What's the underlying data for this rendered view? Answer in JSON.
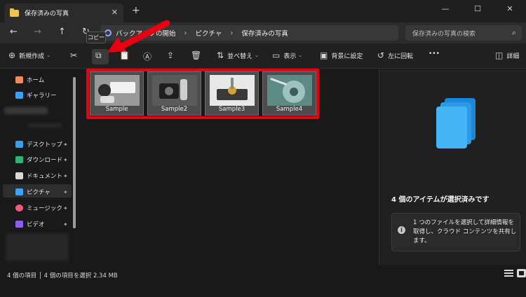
{
  "window": {
    "tab_title": "保存済みの写真",
    "new_tab": "+",
    "close_tab": "✕",
    "minimize": "—",
    "maximize": "☐",
    "close": "✕"
  },
  "address": {
    "crumbs": [
      "バックアップの開始",
      "ピクチャ",
      "保存済みの写真"
    ],
    "separator": "›",
    "search_placeholder": "保存済みの写真の検索"
  },
  "toolbar": {
    "new_label": "新規作成",
    "sort_label": "並べ替え",
    "view_label": "表示",
    "background_label": "背景に設定",
    "rotate_label": "左に回転",
    "more_label": "•••",
    "details_label": "詳細",
    "tooltip": "コピー"
  },
  "sidebar": {
    "items": [
      {
        "label": "ホーム"
      },
      {
        "label": "ギャラリー"
      },
      {
        "label": "デスクトップ"
      },
      {
        "label": "ダウンロード"
      },
      {
        "label": "ドキュメント"
      },
      {
        "label": "ピクチャ"
      },
      {
        "label": "ミュージック"
      },
      {
        "label": "ビデオ"
      }
    ],
    "pin": "📌"
  },
  "files": [
    {
      "name": "Sample"
    },
    {
      "name": "Sample2"
    },
    {
      "name": "Sample3"
    },
    {
      "name": "Sample4"
    }
  ],
  "details": {
    "title": "4 個のアイテムが選択済みです",
    "info": "1 つのファイルを選択して詳細情報を取得し、クラウド コンテンツを共有します。"
  },
  "status": {
    "text": "4 個の項目 │ 4 個の項目を選択 2.34 MB"
  },
  "colors": {
    "accent_frame": "#e60012",
    "arrow": "#e60012"
  }
}
